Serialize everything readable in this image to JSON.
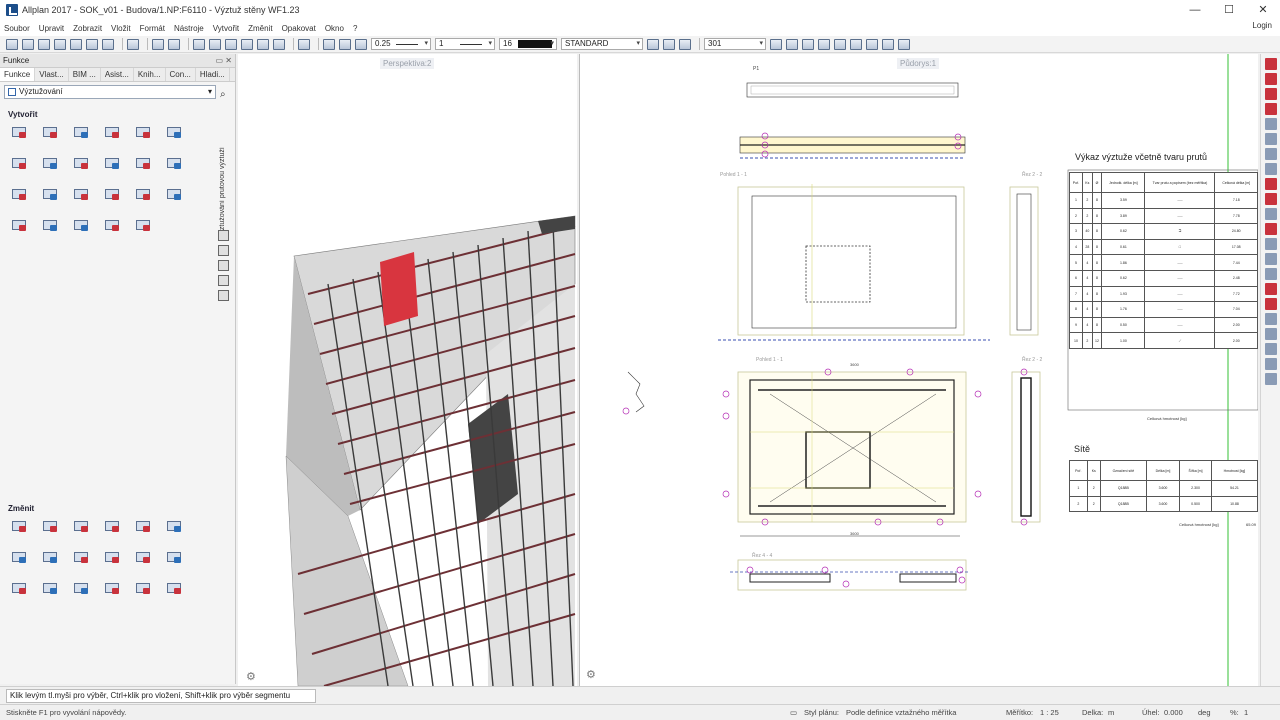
{
  "window": {
    "title": "Allplan 2017 - SOK_v01 - Budova/1.NP:F6110 - Výztuž stěny WF1.23",
    "controls": [
      "—",
      "☐",
      "✕"
    ]
  },
  "menu": {
    "items": [
      "Soubor",
      "Upravit",
      "Zobrazit",
      "Vložit",
      "Formát",
      "Nástroje",
      "Vytvořit",
      "Změnit",
      "Opakovat",
      "Okno",
      "?"
    ],
    "login": "Login"
  },
  "toolbar": {
    "pen_thickness": "0.25",
    "line_type": "1",
    "color_index": "16",
    "layer": "STANDARD",
    "hatch": "301"
  },
  "functions_panel": {
    "title": "Funkce",
    "tabs": [
      "Funkce",
      "Vlast...",
      "BIM ...",
      "Asist...",
      "Knih...",
      "Con...",
      "Hladi..."
    ],
    "module": "Výztužování",
    "vertical_label": "Vyztužování prutovou výztuží",
    "sections": {
      "create": "Vytvořit",
      "modify": "Změnit"
    }
  },
  "viewports": {
    "perspective": "Perspektiva:2",
    "plan": "Půdorys:1"
  },
  "drawing": {
    "sections": [
      "P1",
      "Pohled 1 - 1",
      "Řez 2 - 2",
      "Pohled 1 - 1",
      "Řez 2 - 2",
      "Řez 4 - 4"
    ],
    "dims": [
      "3600",
      "3600"
    ]
  },
  "schedule": {
    "title": "Výkaz výztuže včetně tvaru prutů",
    "headers": [
      "Poř.",
      "Ks",
      "Ø",
      "Jednotk. délka [m]",
      "Tvar prutu a popisem (bez měřítka)",
      "Celková délka [m]"
    ],
    "rows": [
      [
        "1",
        "2",
        "8",
        "3.59",
        "7.18"
      ],
      [
        "2",
        "2",
        "8",
        "3.89",
        "7.78"
      ],
      [
        "3",
        "40",
        "8",
        "0.62",
        "24.80"
      ],
      [
        "4",
        "28",
        "8",
        "0.61",
        "17.08"
      ],
      [
        "5",
        "4",
        "8",
        "1.86",
        "7.44"
      ],
      [
        "6",
        "4",
        "8",
        "0.62",
        "2.48"
      ],
      [
        "7",
        "4",
        "8",
        "1.93",
        "7.72"
      ],
      [
        "8",
        "4",
        "8",
        "1.76",
        "7.04"
      ],
      [
        "9",
        "4",
        "8",
        "0.50",
        "2.00"
      ],
      [
        "10",
        "2",
        "12",
        "1.00",
        "2.00"
      ]
    ],
    "total_label": "Celková hmotnost [kg]"
  },
  "sheets": {
    "title": "Sítě",
    "headers": [
      "Poř.",
      "Ks",
      "Označení sítě",
      "Délka [m]",
      "Šířka [m]",
      "Hmotnost [kg]"
    ],
    "rows": [
      [
        "1",
        "2",
        "Q188B",
        "3.600",
        "2.300",
        "54.21"
      ],
      [
        "2",
        "2",
        "Q188B",
        "3.600",
        "0.500",
        "10.88"
      ]
    ],
    "total_label": "Celková hmotnost [kg]",
    "total_value": "65.09"
  },
  "status": {
    "hint": "Klik levým tl.myši pro výběr, Ctrl+klik pro vložení, Shift+klik pro výběr segmentu",
    "help": "Stiskněte F1 pro vyvolání nápovědy.",
    "plan_style_label": "Styl plánu:",
    "plan_style": "Podle definice vztažného měřítka",
    "scale_label": "Měřítko:",
    "scale": "1 : 25",
    "length_label": "Delka:",
    "length_unit": "m",
    "angle_label": "Úhel:",
    "angle": "0.000",
    "angle_unit": "deg",
    "percent_label": "%:",
    "percent": "1"
  },
  "colors": {
    "accent_red": "#c8323c",
    "rebar": "#8a3a3f",
    "magenta_marker": "#b52fb5",
    "guide_green": "#34c234"
  }
}
